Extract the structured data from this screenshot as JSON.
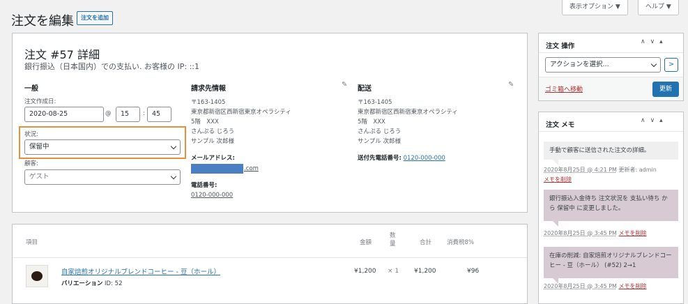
{
  "screen_options": "表示オプション ▼",
  "help": "ヘルプ ▼",
  "page_title": "注文を編集",
  "add_order": "注文を追加",
  "order": {
    "title": "注文 #57 詳細",
    "subtitle": "銀行振込（日本国内）での支払い. お客様の IP: ::1"
  },
  "general": {
    "heading": "一般",
    "date_label": "注文作成日:",
    "date": "2020-08-25",
    "at": "@",
    "hour": "15",
    "colon": ":",
    "minute": "45",
    "status_label": "状況:",
    "status": "保留中",
    "customer_label": "顧客:",
    "customer": "ゲスト"
  },
  "billing": {
    "heading": "請求先情報",
    "lines": [
      "〒163-1405",
      "東京都新宿区西新宿東京オペラシティ",
      "5階　XXX",
      "さんぷる じろう",
      "サンプル 次郎様"
    ],
    "email_label": "メールアドレス:",
    "email_suffix": ".com",
    "phone_label": "電話番号:",
    "phone": "0120-000-000"
  },
  "shipping": {
    "heading": "配送",
    "lines": [
      "〒163-1405",
      "東京都新宿区西新宿東京オペラシティ",
      "5階　XXX",
      "さんぷる じろう",
      "サンプル 次郎様"
    ],
    "phone_label": "送付先電話番号:",
    "phone": "0120-000-000"
  },
  "items": {
    "headers": {
      "item": "項目",
      "cost": "金額",
      "qty": "数量",
      "total": "合計",
      "tax": "消費税8%"
    },
    "row": {
      "name": "自家焙煎オリジナルブレンドコーヒー - 豆（ホール）",
      "variation_label": "バリエーション",
      "variation_id": "ID: 52",
      "cost": "¥1,200",
      "qty": "× 1",
      "total": "¥1,200",
      "tax": "¥96"
    }
  },
  "actions": {
    "title": "注文 操作",
    "select": "アクションを選択...",
    "go": ">",
    "trash": "ゴミ箱へ移動",
    "update": "更新"
  },
  "notes": {
    "title": "注文 メモ",
    "list": [
      {
        "text": "手動で顧客に送信された注文の詳細。",
        "date": "2020年8月25日 @ 4:21 PM",
        "by": "更新者: admin",
        "delete": "メモを削除"
      },
      {
        "text": "銀行振込入金待ち 注文状況を 支払い待ち から 保留中 に変更しました。",
        "date": "2020年8月25日 @ 3:45 PM",
        "delete": "メモを削除"
      },
      {
        "text": "在庫の削減: 自家焙煎オリジナルブレンドコーヒー - 豆（ホール） (#52) 2→1",
        "date": "2020年8月25日 @ 3:45 PM",
        "delete": "メモを削除"
      }
    ]
  },
  "colors": {
    "accent": "#2271b1",
    "highlight": "#e88f3b",
    "redacted": "#4a7fc4"
  }
}
